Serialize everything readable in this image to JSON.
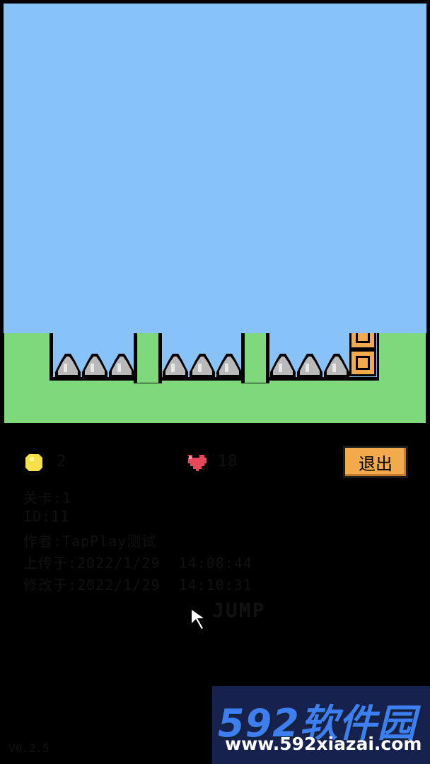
{
  "hud": {
    "coins": "2",
    "lives": "18",
    "exit_label": "退出"
  },
  "level_info": {
    "level": "关卡:1",
    "id": "ID:11",
    "author": "作者:TapPlay测试",
    "uploaded": "上传于:2022/1/29  14:08:44",
    "modified": "修改于:2022/1/29  14:10:31"
  },
  "controls": {
    "jump_label": "JUMP"
  },
  "footer": {
    "version": "V0.2.5"
  },
  "watermark": {
    "logo": "592软件园",
    "url": "www.592xiazai.com"
  },
  "colors": {
    "grass": "#7ed87c",
    "sky": "#87c3f9",
    "block": "#f2aa4c",
    "block_dark": "#9a6a4a",
    "spike": "#b9b9b9",
    "door": "#e07090"
  }
}
